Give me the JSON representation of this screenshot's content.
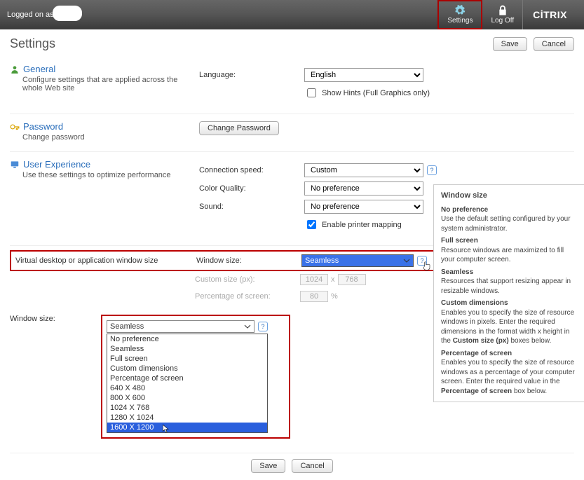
{
  "header": {
    "logged_prefix": "Logged on as: s",
    "settings": "Settings",
    "logoff": "Log Off",
    "brand": "CİTRIX"
  },
  "page": {
    "title": "Settings"
  },
  "buttons": {
    "save": "Save",
    "cancel": "Cancel",
    "change_password": "Change Password"
  },
  "general": {
    "title": "General",
    "desc": "Configure settings that are applied across the whole Web site",
    "language_label": "Language:",
    "language_value": "English",
    "show_hints": "Show Hints (Full Graphics only)"
  },
  "password": {
    "title": "Password",
    "desc": "Change password"
  },
  "ux": {
    "title": "User Experience",
    "desc": "Use these settings to optimize performance",
    "conn_speed_label": "Connection speed:",
    "conn_speed_value": "Custom",
    "color_label": "Color Quality:",
    "color_value": "No preference",
    "sound_label": "Sound:",
    "sound_value": "No preference",
    "printer_label": "Enable printer mapping"
  },
  "virtual": {
    "row_label": "Virtual desktop or application window size",
    "window_size_label": "Window size:",
    "window_size_value": "Seamless",
    "custom_label": "Custom size (px):",
    "custom_w": "1024",
    "custom_x": "x",
    "custom_h": "768",
    "pct_label": "Percentage of screen:",
    "pct_value": "80",
    "pct_suffix": "%"
  },
  "dropdown": {
    "label": "Window size:",
    "selected": "Seamless",
    "options": [
      "No preference",
      "Seamless",
      "Full screen",
      "Custom dimensions",
      "Percentage of screen",
      "640 X 480",
      "800 X 600",
      "1024 X 768",
      "1280 X 1024",
      "1600 X 1200"
    ],
    "highlighted_index": 9
  },
  "tooltip": {
    "title": "Window size",
    "np_h": "No preference",
    "np_t": "Use the default setting configured by your system administrator.",
    "fs_h": "Full screen",
    "fs_t": "Resource windows are maximized to fill your computer screen.",
    "sm_h": "Seamless",
    "sm_t": "Resources that support resizing appear in resizable windows.",
    "cd_h": "Custom dimensions",
    "cd_t1": "Enables you to specify the size of resource windows in pixels. Enter the required dimensions in the format width x height in the ",
    "cd_b": "Custom size (px)",
    "cd_t2": " boxes below.",
    "ps_h": "Percentage of screen",
    "ps_t1": "Enables you to specify the size of resource windows as a percentage of your computer screen. Enter the required value in the ",
    "ps_b": "Percentage of screen",
    "ps_t2": " box below."
  }
}
